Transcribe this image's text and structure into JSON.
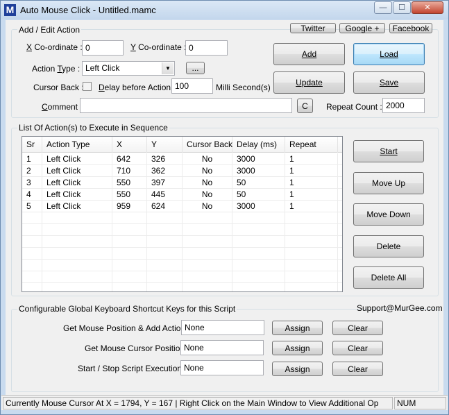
{
  "window": {
    "title": "Auto Mouse Click - Untitled.mamc",
    "icon_letter": "M",
    "controls": {
      "minimize": "—",
      "maximize": "☐",
      "close": "✕"
    }
  },
  "links": {
    "twitter": "Twitter",
    "google": "Google +",
    "facebook": "Facebook"
  },
  "add_edit": {
    "group_title": "Add / Edit Action",
    "x_label_u": "X",
    "x_label_rest": " Co-ordinate :",
    "x_value": "0",
    "y_label_u": "Y",
    "y_label_rest": " Co-ordinate :",
    "y_value": "0",
    "action_type_label_pre": "Action ",
    "action_type_label_u": "T",
    "action_type_label_post": "ype :",
    "action_type_value": "Left Click",
    "more_button": "...",
    "cursor_back_label": "Cursor Back :",
    "delay_label_u": "D",
    "delay_label_rest": "elay before Action :",
    "delay_value": "100",
    "delay_unit": "Milli Second(s)",
    "comment_label_u": "C",
    "comment_label_rest": "omment :",
    "comment_value": "",
    "clear_comment_button": "C",
    "repeat_count_label": "Repeat Count :",
    "repeat_count_value": "2000",
    "buttons": {
      "add": "Add",
      "load": "Load",
      "update": "Update",
      "save": "Save"
    }
  },
  "list_section": {
    "group_title": "List Of Action(s) to Execute in Sequence",
    "columns": [
      "Sr",
      "Action Type",
      "X",
      "Y",
      "Cursor Back",
      "Delay (ms)",
      "Repeat"
    ],
    "rows": [
      [
        "1",
        "Left Click",
        "642",
        "326",
        "No",
        "3000",
        "1"
      ],
      [
        "2",
        "Left Click",
        "710",
        "362",
        "No",
        "3000",
        "1"
      ],
      [
        "3",
        "Left Click",
        "550",
        "397",
        "No",
        "50",
        "1"
      ],
      [
        "4",
        "Left Click",
        "550",
        "445",
        "No",
        "50",
        "1"
      ],
      [
        "5",
        "Left Click",
        "959",
        "624",
        "No",
        "3000",
        "1"
      ]
    ],
    "buttons": {
      "start": "Start",
      "move_up": "Move Up",
      "move_down": "Move Down",
      "delete": "Delete",
      "delete_all": "Delete All"
    }
  },
  "shortcuts": {
    "group_title": "Configurable Global Keyboard Shortcut Keys for this Script",
    "support_email": "Support@MurGee.com",
    "items": [
      {
        "label": "Get Mouse Position & Add Action :",
        "value": "None",
        "assign": "Assign",
        "clear": "Clear"
      },
      {
        "label": "Get Mouse Cursor Position :",
        "value": "None",
        "assign": "Assign",
        "clear": "Clear"
      },
      {
        "label": "Start / Stop Script Execution :",
        "value": "None",
        "assign": "Assign",
        "clear": "Clear"
      }
    ]
  },
  "status": {
    "message": "Currently Mouse Cursor At X = 1794, Y = 167 | Right Click on the Main Window to View Additional Op",
    "num": "NUM"
  }
}
